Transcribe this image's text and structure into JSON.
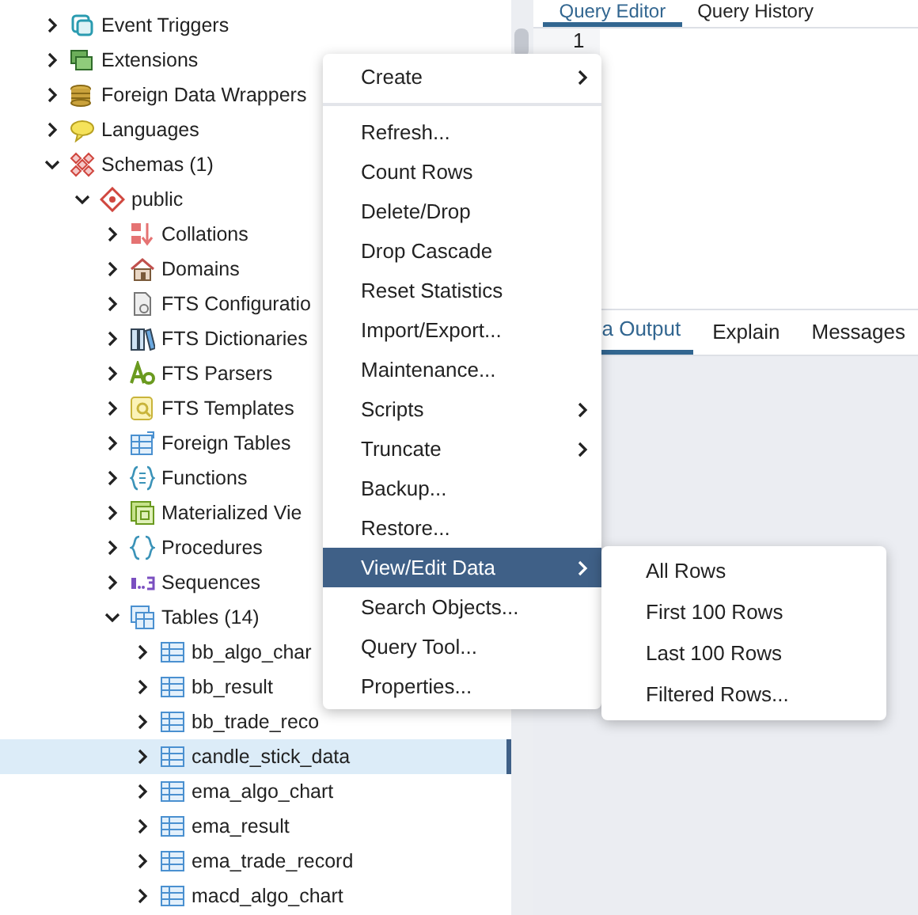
{
  "tree": [
    {
      "label": "Event Triggers",
      "expanded": false,
      "selected": false
    },
    {
      "label": "Extensions",
      "expanded": false,
      "selected": false
    },
    {
      "label": "Foreign Data Wrappers",
      "expanded": false,
      "selected": false
    },
    {
      "label": "Languages",
      "expanded": false,
      "selected": false
    },
    {
      "label": "Schemas (1)",
      "expanded": true,
      "selected": false,
      "children": [
        {
          "label": "public",
          "expanded": true,
          "selected": false,
          "children": [
            {
              "label": "Collations",
              "expanded": false,
              "selected": false
            },
            {
              "label": "Domains",
              "expanded": false,
              "selected": false
            },
            {
              "label": "FTS Configuratio",
              "expanded": false,
              "selected": false
            },
            {
              "label": "FTS Dictionaries",
              "expanded": false,
              "selected": false
            },
            {
              "label": "FTS Parsers",
              "expanded": false,
              "selected": false
            },
            {
              "label": "FTS Templates",
              "expanded": false,
              "selected": false
            },
            {
              "label": "Foreign Tables",
              "expanded": false,
              "selected": false
            },
            {
              "label": "Functions",
              "expanded": false,
              "selected": false
            },
            {
              "label": "Materialized Vie",
              "expanded": false,
              "selected": false
            },
            {
              "label": "Procedures",
              "expanded": false,
              "selected": false
            },
            {
              "label": "Sequences",
              "expanded": false,
              "selected": false
            },
            {
              "label": "Tables (14)",
              "expanded": true,
              "selected": false,
              "children": [
                {
                  "label": "bb_algo_char",
                  "expanded": false,
                  "selected": false
                },
                {
                  "label": "bb_result",
                  "expanded": false,
                  "selected": false
                },
                {
                  "label": "bb_trade_reco",
                  "expanded": false,
                  "selected": false
                },
                {
                  "label": "candle_stick_data",
                  "expanded": false,
                  "selected": true
                },
                {
                  "label": "ema_algo_chart",
                  "expanded": false,
                  "selected": false
                },
                {
                  "label": "ema_result",
                  "expanded": false,
                  "selected": false
                },
                {
                  "label": "ema_trade_record",
                  "expanded": false,
                  "selected": false
                },
                {
                  "label": "macd_algo_chart",
                  "expanded": false,
                  "selected": false
                }
              ]
            }
          ]
        }
      ]
    }
  ],
  "editor_tabs": [
    {
      "label": "Query Editor",
      "selected": true
    },
    {
      "label": "Query History",
      "selected": false
    }
  ],
  "editor": {
    "line_numbers": [
      "1"
    ]
  },
  "output_tabs": [
    {
      "label": "a Output",
      "selected": true
    },
    {
      "label": "Explain",
      "selected": false
    },
    {
      "label": "Messages",
      "selected": false
    }
  ],
  "context_menu": {
    "groups": [
      [
        {
          "label": "Create",
          "submenu": true,
          "selected": false
        }
      ],
      [
        {
          "label": "Refresh...",
          "submenu": false,
          "selected": false
        },
        {
          "label": "Count Rows",
          "submenu": false,
          "selected": false
        },
        {
          "label": "Delete/Drop",
          "submenu": false,
          "selected": false
        },
        {
          "label": "Drop Cascade",
          "submenu": false,
          "selected": false
        },
        {
          "label": "Reset Statistics",
          "submenu": false,
          "selected": false
        },
        {
          "label": "Import/Export...",
          "submenu": false,
          "selected": false
        },
        {
          "label": "Maintenance...",
          "submenu": false,
          "selected": false
        },
        {
          "label": "Scripts",
          "submenu": true,
          "selected": false
        },
        {
          "label": "Truncate",
          "submenu": true,
          "selected": false
        },
        {
          "label": "Backup...",
          "submenu": false,
          "selected": false
        },
        {
          "label": "Restore...",
          "submenu": false,
          "selected": false
        },
        {
          "label": "View/Edit Data",
          "submenu": true,
          "selected": true
        },
        {
          "label": "Search Objects...",
          "submenu": false,
          "selected": false
        },
        {
          "label": "Query Tool...",
          "submenu": false,
          "selected": false
        },
        {
          "label": "Properties...",
          "submenu": false,
          "selected": false
        }
      ]
    ]
  },
  "submenu": [
    {
      "label": "All Rows",
      "selected": false
    },
    {
      "label": "First 100 Rows",
      "selected": false
    },
    {
      "label": "Last 100 Rows",
      "selected": false
    },
    {
      "label": "Filtered Rows...",
      "selected": false
    }
  ]
}
